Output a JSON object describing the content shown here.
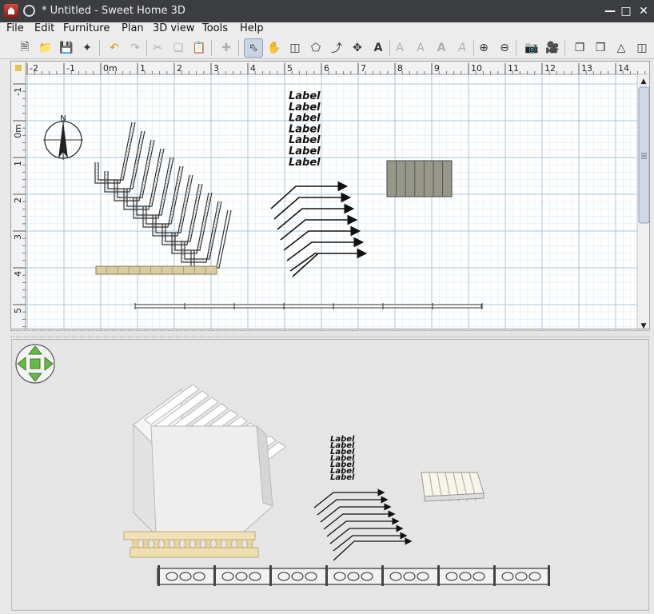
{
  "window": {
    "title": "* Untitled - Sweet Home 3D"
  },
  "menu": {
    "file": "File",
    "edit": "Edit",
    "furniture": "Furniture",
    "plan": "Plan",
    "view3d": "3D view",
    "tools": "Tools",
    "help": "Help"
  },
  "plan": {
    "ruler_x": [
      "-2",
      "-1",
      "0m",
      "1",
      "2",
      "3",
      "4",
      "5",
      "6",
      "7",
      "8",
      "9",
      "10",
      "11",
      "12",
      "13",
      "14"
    ],
    "ruler_y": [
      "-1",
      "0m",
      "1",
      "2",
      "3",
      "4",
      "5"
    ],
    "compass_letter": "N",
    "label_text": "Label"
  },
  "view3d": {
    "label_text": "Label"
  }
}
